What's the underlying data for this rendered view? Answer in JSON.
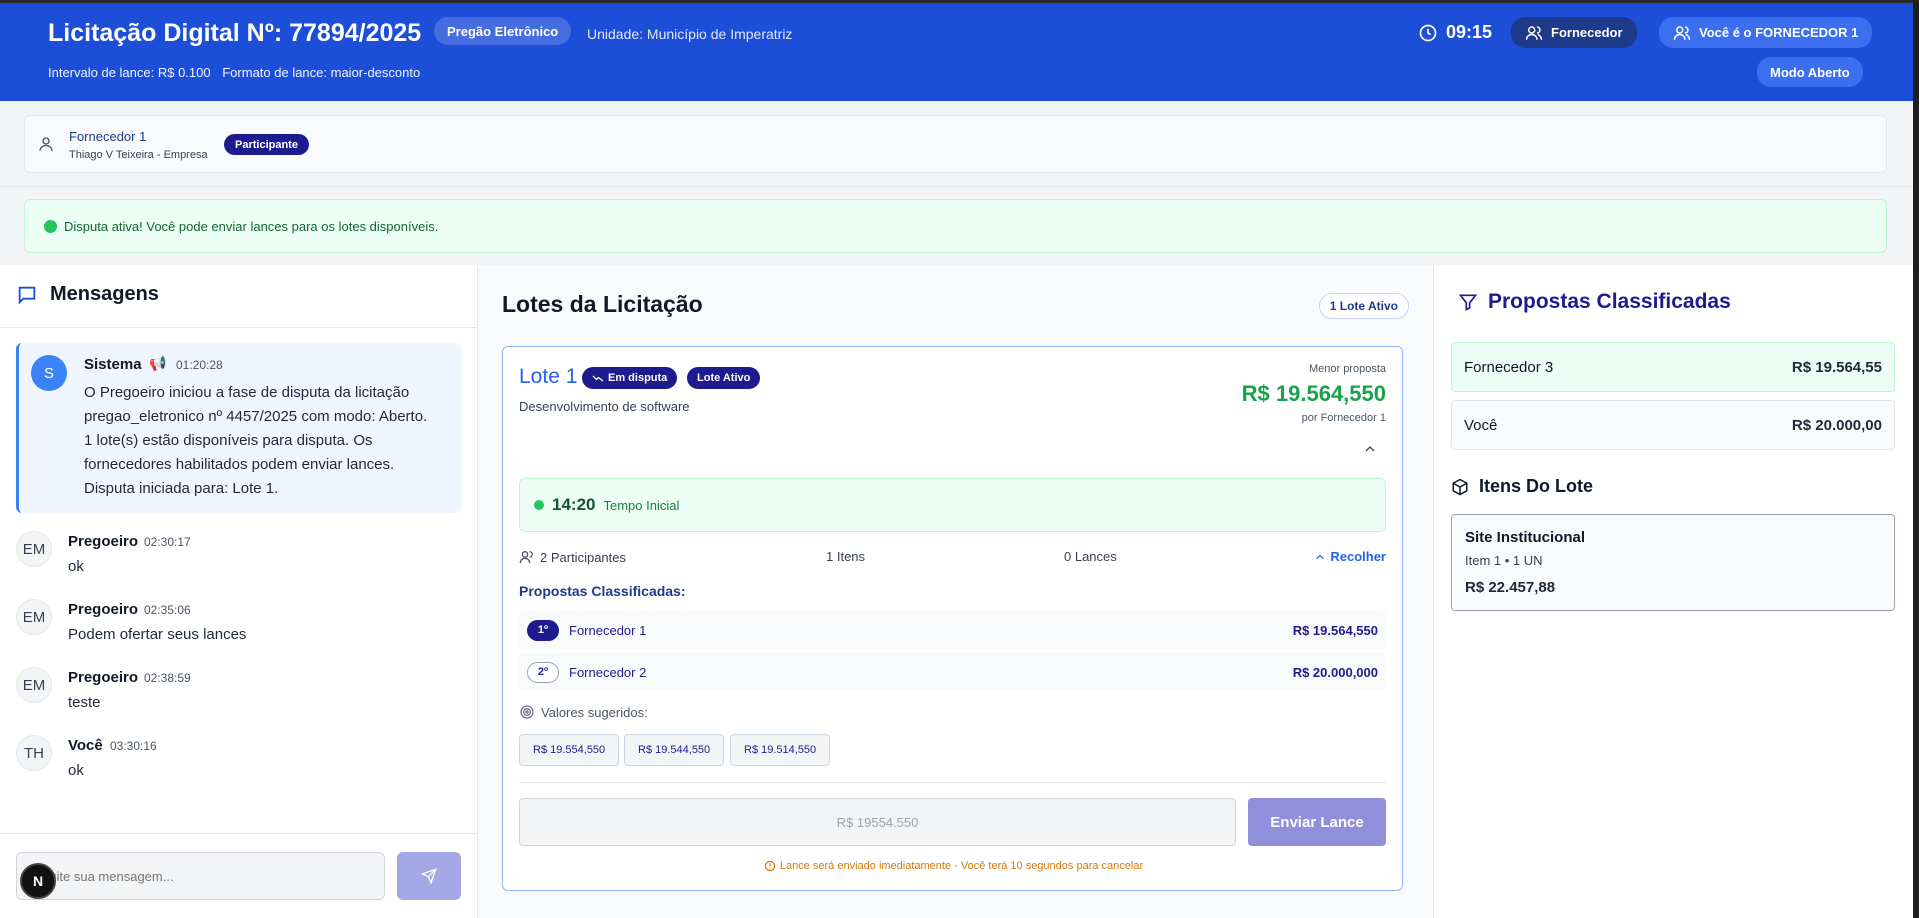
{
  "header": {
    "title": "Licitação Digital Nº: 77894/2025",
    "modalidade": "Pregão Eletrônico",
    "unidade": "Unidade: Município de Imperatriz",
    "intervalo": "Intervalo de lance: R$ 0.100",
    "formato": "Formato de lance: maior-desconto",
    "clock": "09:15",
    "role_badge": "Fornecedor",
    "you_badge": "Você é o FORNECEDOR 1",
    "mode_badge": "Modo Aberto",
    "colors": {
      "bg": "#1d4ed8",
      "dark_badge": "#1e3a8a"
    }
  },
  "user": {
    "name": "Fornecedor 1",
    "company": "Thiago V Teixeira - Empresa",
    "badge": "Participante"
  },
  "alert": {
    "text": "Disputa ativa! Você pode enviar lances para os lotes disponíveis.",
    "color": "#22c55e"
  },
  "messages": {
    "title": "Mensagens",
    "items": [
      {
        "avatar": "S",
        "author": "Sistema",
        "emoji": "📢",
        "time": "01:20:28",
        "lines": [
          "O Pregoeiro iniciou a fase de disputa da licitação",
          "pregao_eletronico nº 4457/2025 com modo: Aberto.",
          "1 lote(s) estão disponíveis para disputa. Os",
          "fornecedores habilitados podem enviar lances.",
          "Disputa iniciada para: Lote 1."
        ]
      },
      {
        "avatar": "EM",
        "author": "Pregoeiro",
        "time": "02:30:17",
        "text": "ok"
      },
      {
        "avatar": "EM",
        "author": "Pregoeiro",
        "time": "02:35:06",
        "text": "Podem ofertar seus lances"
      },
      {
        "avatar": "EM",
        "author": "Pregoeiro",
        "time": "02:38:59",
        "text": "teste"
      },
      {
        "avatar": "TH",
        "author": "Você",
        "time": "03:30:16",
        "text": "ok"
      }
    ],
    "input_placeholder": "Digite sua mensagem...",
    "fab_label": "N"
  },
  "lotes": {
    "title": "Lotes da Licitação",
    "active_count": "1 Lote Ativo",
    "lote": {
      "name": "Lote 1",
      "status_tag": "Em disputa",
      "active_tag": "Lote Ativo",
      "description": "Desenvolvimento de software",
      "menor_label": "Menor proposta",
      "menor_value": "R$ 19.564,550",
      "menor_por": "por Fornecedor 1",
      "timer_value": "14:20",
      "timer_label": "Tempo Inicial",
      "participants": "2 Participantes",
      "items": "1 Itens",
      "lances": "0 Lances",
      "collapse": "Recolher",
      "proposals_title": "Propostas Classificadas:",
      "proposals": [
        {
          "rank": "1º",
          "name": "Fornecedor 1",
          "value": "R$ 19.564,550"
        },
        {
          "rank": "2º",
          "name": "Fornecedor 2",
          "value": "R$ 20.000,000"
        }
      ],
      "suggested_title": "Valores sugeridos:",
      "suggested": [
        "R$ 19.554,550",
        "R$ 19.544,550",
        "R$ 19.514,550"
      ],
      "bid_placeholder": "R$ 19554.550",
      "bid_button": "Enviar Lance",
      "warning": "Lance será enviado imediatamente - Você terá 10 segundos para cancelar"
    }
  },
  "classificadas": {
    "title": "Propostas Classificadas",
    "rows": [
      {
        "name": "Fornecedor 3",
        "value": "R$ 19.564,55"
      },
      {
        "name": "Você",
        "value": "R$ 20.000,00"
      }
    ],
    "items_title": "Itens Do Lote",
    "item": {
      "name": "Site Institucional",
      "meta": "Item 1 • 1 UN",
      "value": "R$ 22.457,88"
    }
  }
}
